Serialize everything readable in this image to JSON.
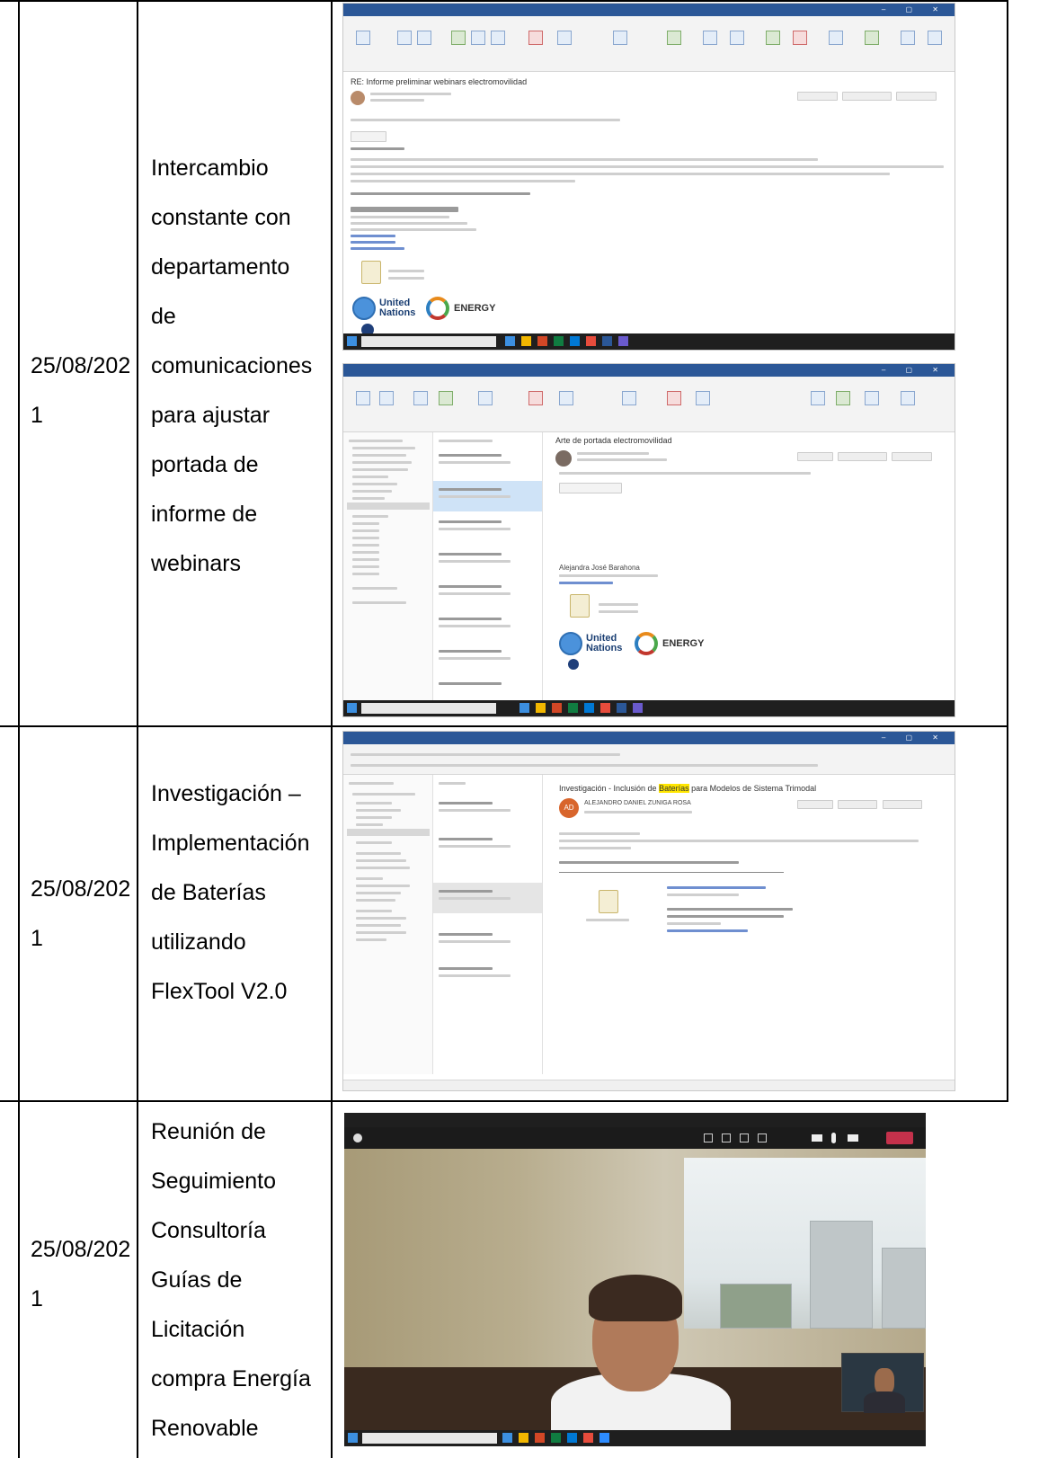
{
  "rows": [
    {
      "date": [
        "25/08/202",
        "1"
      ],
      "description": [
        "Intercambio",
        "constante con",
        "departamento",
        "de",
        "comunicaciones",
        "para ajustar",
        "portada de",
        "informe de",
        "webinars"
      ]
    },
    {
      "date": [
        "25/08/202",
        "1"
      ],
      "description": [
        "Investigación –",
        "Implementación",
        "de Baterías",
        "utilizando",
        "FlexTool V2.0"
      ]
    },
    {
      "date": [
        "25/08/202",
        "1"
      ],
      "description": [
        "Reunión de",
        "Seguimiento",
        "Consultoría",
        "Guías de",
        "Licitación",
        "compra Energía",
        "Renovable"
      ]
    }
  ],
  "screenshots": {
    "email1": {
      "subject": "RE: Informe preliminar webinars electromovilidad",
      "logo_un": [
        "United",
        "Nations"
      ],
      "logo_energy": "ENERGY"
    },
    "email2": {
      "subject": "Arte de portada electromovilidad",
      "sender": "Alejandra José Barahona",
      "logo_un": [
        "United",
        "Nations"
      ],
      "logo_energy": "ENERGY"
    },
    "email3": {
      "subject_before": "Investigación - Inclusión de ",
      "subject_highlight": "Baterías",
      "subject_after": " para Modelos de Sistema Trimodal",
      "sender": "ALEJANDRO DANIEL ZUNIGA ROSA",
      "avatar": "AD"
    }
  },
  "colors": {
    "outlook_blue": "#2b5797",
    "highlight": "#ffe600",
    "teams_leave": "#c4314b"
  }
}
